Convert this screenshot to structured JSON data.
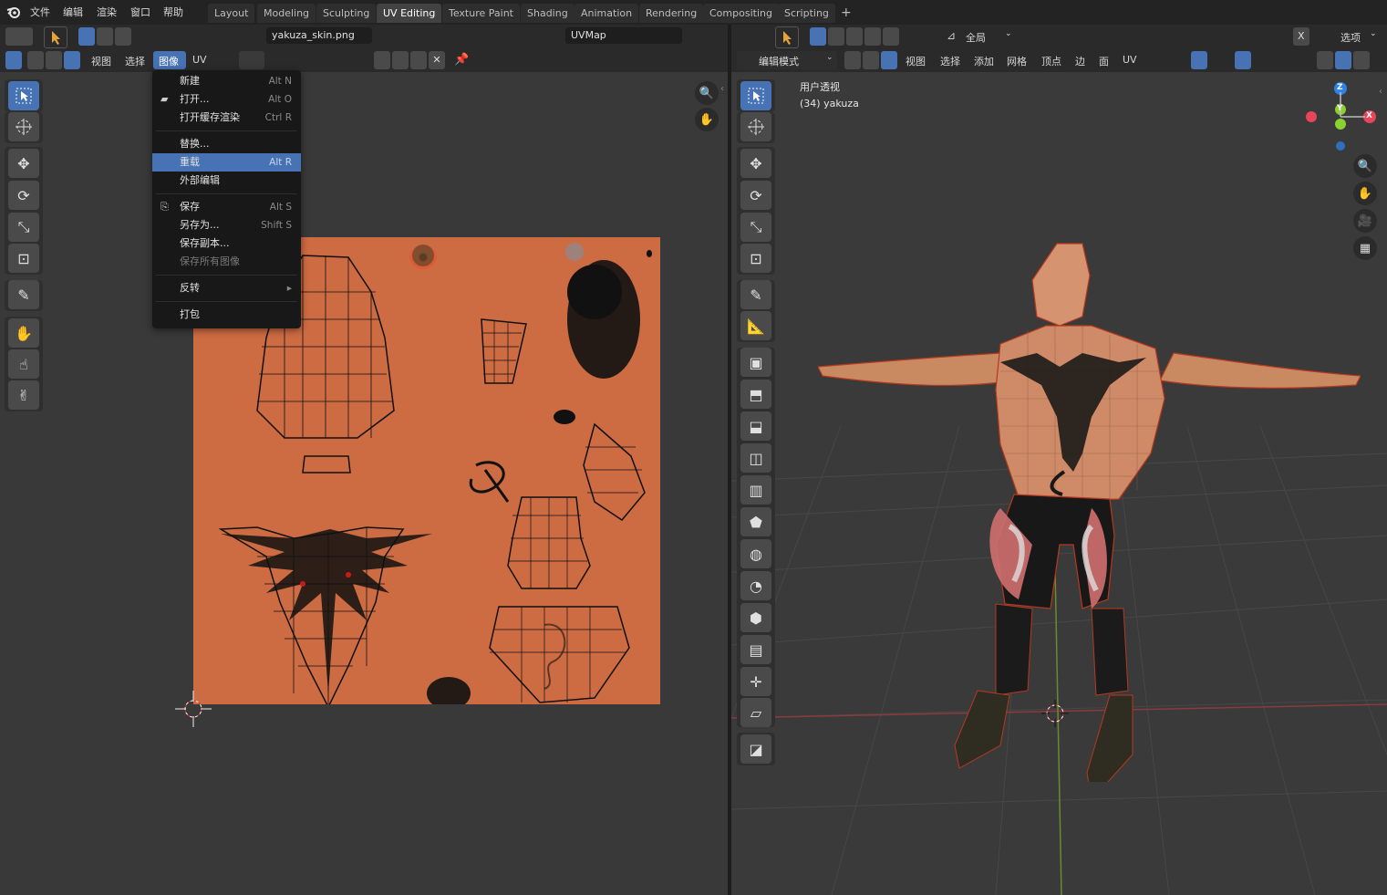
{
  "app": {
    "logo": "blender-logo-icon",
    "menus": [
      "文件",
      "编辑",
      "渲染",
      "窗口",
      "帮助"
    ],
    "workspaces": [
      "Layout",
      "Modeling",
      "Sculpting",
      "UV Editing",
      "Texture Paint",
      "Shading",
      "Animation",
      "Rendering",
      "Compositing",
      "Scripting"
    ],
    "active_workspace": "UV Editing",
    "add_tab": "+"
  },
  "uv_editor": {
    "menus": [
      "视图",
      "选择",
      "图像",
      "UV"
    ],
    "image_name": "yakuza_skin.png",
    "uv_map": "UVMap",
    "image_menu": {
      "items": [
        {
          "label": "新建",
          "shortcut": "Alt N"
        },
        {
          "label": "打开...",
          "shortcut": "Alt O"
        },
        {
          "label": "打开缓存渲染",
          "shortcut": "Ctrl R"
        },
        {
          "label": "替换...",
          "shortcut": ""
        },
        {
          "label": "重载",
          "shortcut": "Alt R"
        },
        {
          "label": "外部编辑",
          "shortcut": ""
        },
        {
          "label": "保存",
          "shortcut": "Alt S"
        },
        {
          "label": "另存为...",
          "shortcut": "Shift S"
        },
        {
          "label": "保存副本...",
          "shortcut": ""
        },
        {
          "label": "保存所有图像",
          "shortcut": ""
        },
        {
          "label": "反转",
          "shortcut": ""
        },
        {
          "label": "打包",
          "shortcut": ""
        }
      ],
      "highlighted": "重载",
      "disabled": "保存所有图像",
      "submenu_arrow": "▸"
    },
    "texture_color": "#cd6b43"
  },
  "viewport": {
    "mode": "编辑模式",
    "orientation": "全局",
    "options": "选项",
    "menus": [
      "视图",
      "选择",
      "添加",
      "网格",
      "顶点",
      "边",
      "面",
      "UV"
    ],
    "overlay_title": "用户透视",
    "object_info": "(34) yakuza",
    "gizmo_axes": {
      "z": "Z",
      "y": "Y",
      "x": "X"
    },
    "colors": {
      "x": "#e8455b",
      "y": "#8bd12f",
      "z": "#2f82e6",
      "accent": "#4772b3"
    }
  }
}
